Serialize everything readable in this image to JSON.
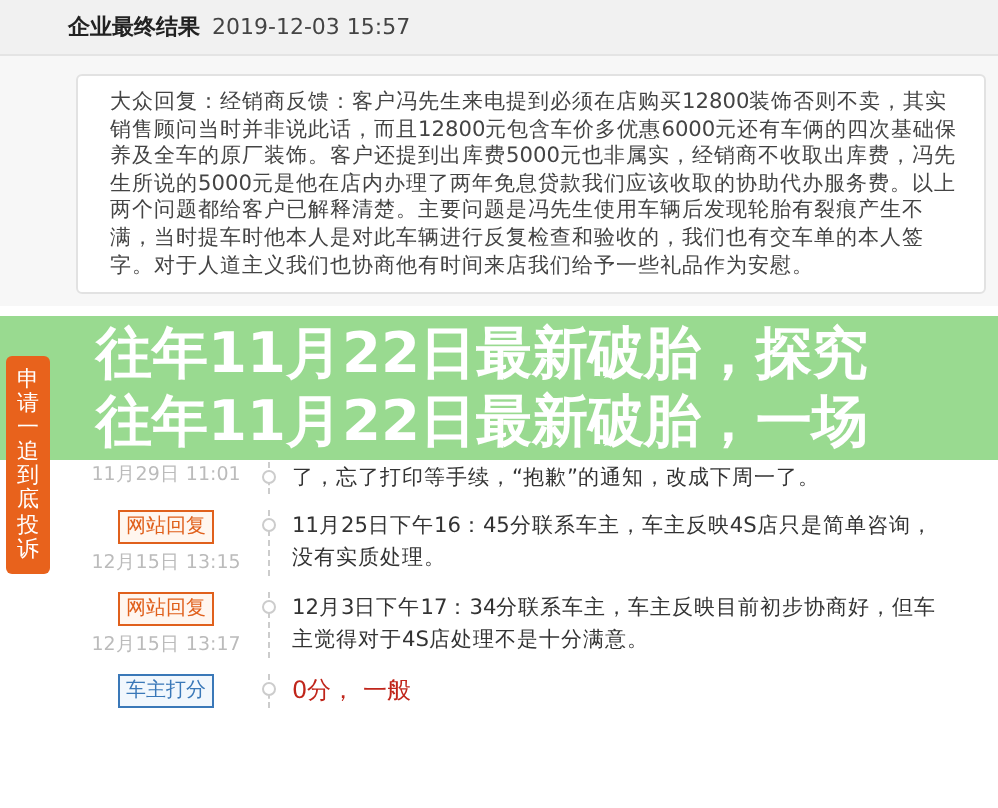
{
  "header": {
    "title": "企业最终结果",
    "time": "2019-12-03 15:57"
  },
  "reply": "大众回复：经销商反馈：客户冯先生来电提到必须在店购买12800装饰否则不卖，其实销售顾问当时并非说此话，而且12800元包含车价多优惠6000元还有车俩的四次基础保养及全车的原厂装饰。客户还提到出库费5000元也非属实，经销商不收取出库费，冯先生所说的5000元是他在店内办理了两年免息贷款我们应该收取的协助代办服务费。以上两个问题都给客户已解释清楚。主要问题是冯先生使用车辆后发现轮胎有裂痕产生不满，当时提车时他本人是对此车辆进行反复检查和验收的，我们也有交车单的本人签字。对于人道主义我们也协商他有时间来店我们给予一些礼品作为安慰。",
  "side_tab": "申请一追到底投诉",
  "banner": [
    "往年11月22日最新破胎，探究",
    "往年11月22日最新破胎，一场"
  ],
  "timeline": [
    {
      "date": "11月29日 11:01",
      "text": "了，忘了打印等手续，“抱歉”的通知，改成下周一了。",
      "kind": "note"
    },
    {
      "badge": {
        "label": "网站回复",
        "kind": "site"
      },
      "date": "12月15日 13:15",
      "text": "11月25日下午16：45分联系车主，车主反映4S店只是简单咨询，没有实质处理。",
      "kind": "note"
    },
    {
      "badge": {
        "label": "网站回复",
        "kind": "site"
      },
      "date": "12月15日 13:17",
      "text": "12月3日下午17：34分联系车主，车主反映目前初步协商好，但车主觉得对于4S店处理不是十分满意。",
      "kind": "note"
    },
    {
      "badge": {
        "label": "车主打分",
        "kind": "owner"
      },
      "text": "0分， 一般",
      "kind": "score"
    }
  ]
}
